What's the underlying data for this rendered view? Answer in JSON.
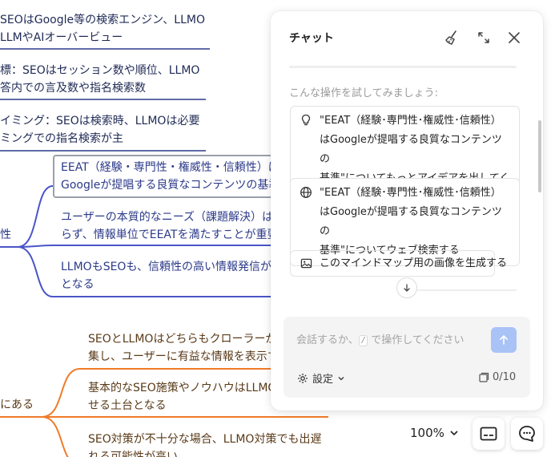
{
  "mindmap": {
    "top_nodes": [
      {
        "line1": "SEOはGoogle等の検索エンジン、LLMO",
        "line2": "LLMやAIオーバービュー"
      },
      {
        "line1": "標：SEOはセッション数や順位、LLMO",
        "line2": "答内での言及数や指名検索数"
      },
      {
        "line1": "イミング：SEOは検索時、LLMOは必要",
        "line2": "ミングでの指名検索が主"
      }
    ],
    "blue_branch_label": "性",
    "blue_nodes": [
      {
        "line1": "EEAT（経験・専門性・権威性・信頼性）は",
        "line2": "Googleが提唱する良質なコンテンツの基準"
      },
      {
        "line1": "ユーザーの本質的なニーズ（課題解決）は",
        "line2": "らず、情報単位でEEATを満たすことが重要"
      },
      {
        "line1": "LLMOもSEOも、信頼性の高い情報発信が",
        "line2": "となる"
      }
    ],
    "orange_branch_label": "にある",
    "orange_nodes": [
      {
        "line1": "SEOとLLMOはどちらもクローラーが",
        "line2": "集し、ユーザーに有益な情報を表示す"
      },
      {
        "line1": "基本的なSEO施策やノウハウはLLMO",
        "line2": "せる土台となる"
      },
      {
        "line1": "SEO対策が不十分な場合、LLMO対策でも出遅",
        "line2": "れる可能性が高い"
      }
    ],
    "colors": {
      "navy": "#1f2a55",
      "blue_link": "#4a55c8",
      "orange_link": "#f07b2a"
    }
  },
  "chat": {
    "title": "チャット",
    "try_label": "こんな操作を試してみましょう:",
    "suggestions": [
      {
        "icon": "lightbulb-icon",
        "lines": [
          "\"EEAT（経験･専門性･権威性･信頼性）",
          "はGoogleが提唱する良質なコンテンツの",
          "基準\"についてもっとアイデアを出してください"
        ]
      },
      {
        "icon": "globe-icon",
        "lines": [
          "\"EEAT（経験･専門性･権威性･信頼性）",
          "はGoogleが提唱する良質なコンテンツの",
          "基準\"についてウェブ検索する"
        ]
      }
    ],
    "image_suggestion": {
      "icon": "image-icon",
      "label": "このマインドマップ用の画像を生成する"
    },
    "composer": {
      "placeholder_before": "会話するか、",
      "slash": "/",
      "placeholder_after": " で操作してください"
    },
    "settings_label": "設定",
    "counter": "0/10",
    "accent": "#a9c3f7"
  },
  "controls": {
    "zoom": "100%"
  }
}
